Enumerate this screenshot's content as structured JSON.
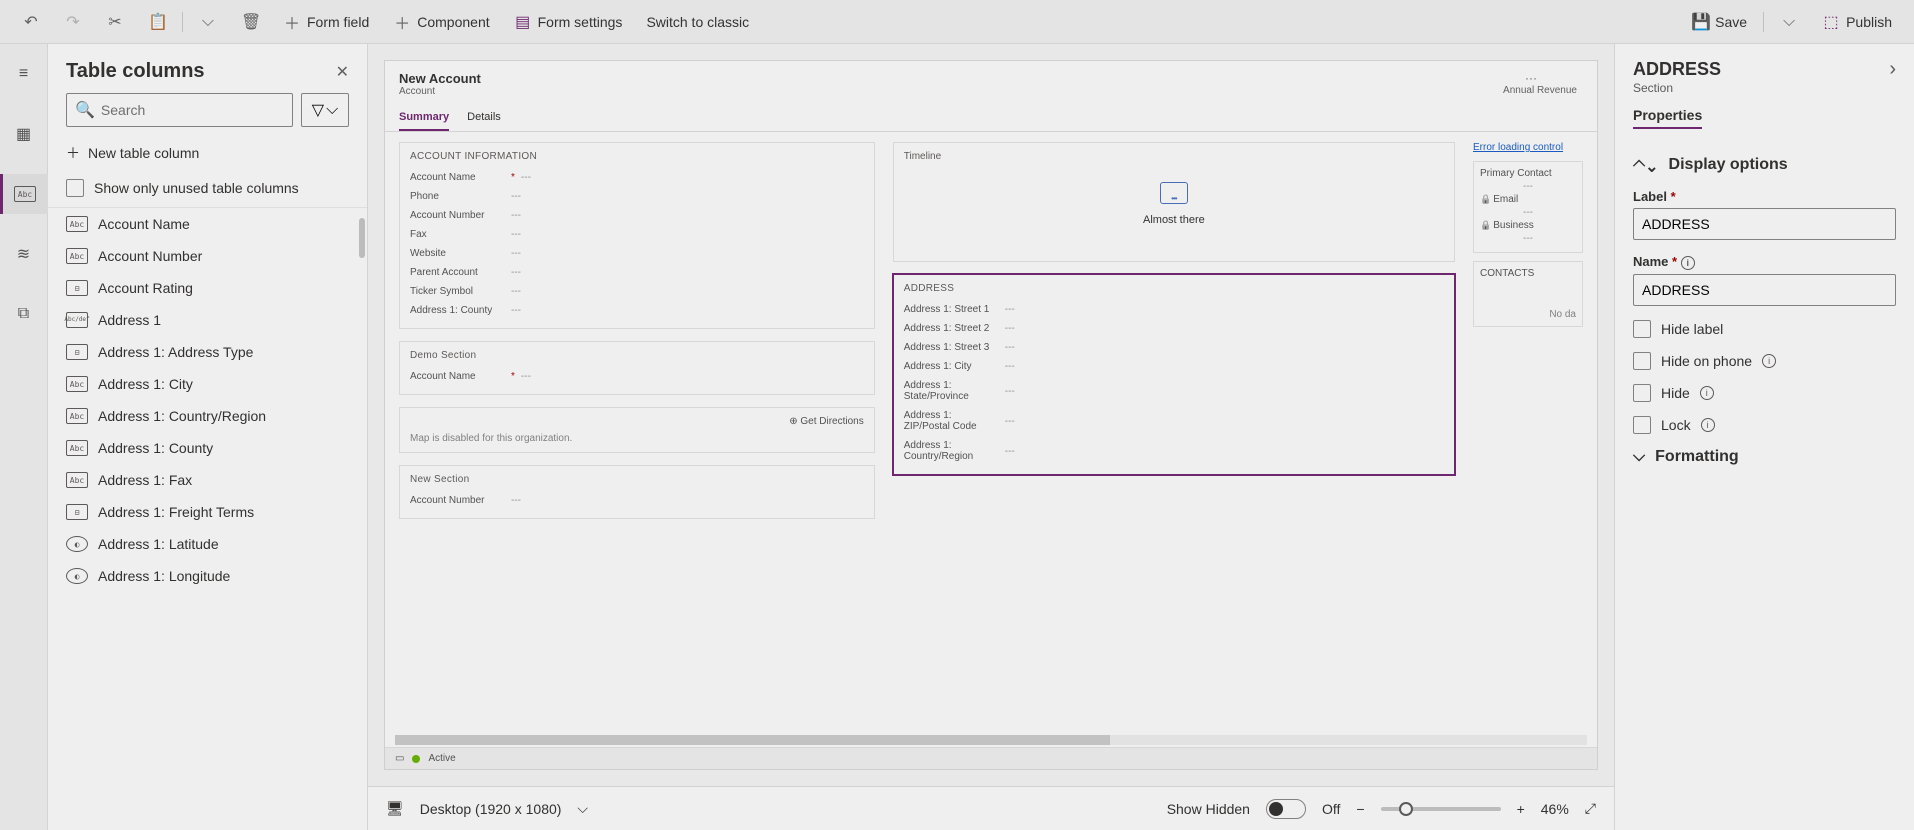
{
  "topbar": {
    "undo": "↶",
    "redo": "↷",
    "cut": "✂",
    "paste": "📋",
    "form_field": "Form field",
    "component": "Component",
    "form_settings": "Form settings",
    "switch_classic": "Switch to classic",
    "save": "Save",
    "publish": "Publish"
  },
  "table_columns": {
    "title": "Table columns",
    "search_placeholder": "Search",
    "new_table_column": "New table column",
    "show_only_unused": "Show only unused table columns",
    "items": [
      {
        "icon": "Abc",
        "label": "Account Name"
      },
      {
        "icon": "Abc",
        "label": "Account Number"
      },
      {
        "icon": "⊟",
        "label": "Account Rating"
      },
      {
        "icon": "Abc/def",
        "label": "Address 1"
      },
      {
        "icon": "⊟",
        "label": "Address 1: Address Type"
      },
      {
        "icon": "Abc",
        "label": "Address 1: City"
      },
      {
        "icon": "Abc",
        "label": "Address 1: Country/Region"
      },
      {
        "icon": "Abc",
        "label": "Address 1: County"
      },
      {
        "icon": "Abc",
        "label": "Address 1: Fax"
      },
      {
        "icon": "⊟",
        "label": "Address 1: Freight Terms"
      },
      {
        "icon": "◐",
        "label": "Address 1: Latitude"
      },
      {
        "icon": "◐",
        "label": "Address 1: Longitude"
      }
    ]
  },
  "canvas": {
    "header": {
      "title": "New Account",
      "subtitle": "Account",
      "revenue_label": "Annual Revenue",
      "ellipsis": "···"
    },
    "tabs": [
      {
        "label": "Summary",
        "active": true
      },
      {
        "label": "Details",
        "active": false
      }
    ],
    "account_info": {
      "title": "ACCOUNT INFORMATION",
      "fields": [
        {
          "name": "Account Name",
          "required": true,
          "value": "---"
        },
        {
          "name": "Phone",
          "value": "---"
        },
        {
          "name": "Account Number",
          "value": "---"
        },
        {
          "name": "Fax",
          "value": "---"
        },
        {
          "name": "Website",
          "value": "---"
        },
        {
          "name": "Parent Account",
          "value": "---"
        },
        {
          "name": "Ticker Symbol",
          "value": "---"
        },
        {
          "name": "Address 1: County",
          "value": "---"
        }
      ]
    },
    "demo_section": {
      "title": "Demo Section",
      "field_name": "Account Name",
      "required": true,
      "value": "---"
    },
    "map_section": {
      "get_directions": "Get Directions",
      "disabled_msg": "Map is disabled for this organization."
    },
    "new_section": {
      "title": "New Section",
      "field_name": "Account Number",
      "value": "---"
    },
    "timeline": {
      "title": "Timeline",
      "empty_msg": "Almost there"
    },
    "address": {
      "title": "ADDRESS",
      "fields": [
        {
          "name": "Address 1: Street 1",
          "value": "---"
        },
        {
          "name": "Address 1: Street 2",
          "value": "---"
        },
        {
          "name": "Address 1: Street 3",
          "value": "---"
        },
        {
          "name": "Address 1: City",
          "value": "---"
        },
        {
          "name": "Address 1: State/Province",
          "value": "---"
        },
        {
          "name": "Address 1: ZIP/Postal Code",
          "value": "---"
        },
        {
          "name": "Address 1: Country/Region",
          "value": "---"
        }
      ]
    },
    "side": {
      "error": "Error loading control",
      "primary_contact": "Primary Contact",
      "email": "Email",
      "business": "Business",
      "contacts": "CONTACTS",
      "nodata": "No da",
      "dash": "---"
    },
    "status_bar": {
      "status": "Active"
    }
  },
  "bottom": {
    "desktop": "Desktop (1920 x 1080)",
    "show_hidden": "Show Hidden",
    "off": "Off",
    "zoom": "46%"
  },
  "props": {
    "title": "ADDRESS",
    "subtitle": "Section",
    "tab": "Properties",
    "display_options": "Display options",
    "label_label": "Label",
    "label_value": "ADDRESS",
    "name_label": "Name",
    "name_value": "ADDRESS",
    "hide_label": "Hide label",
    "hide_on_phone": "Hide on phone",
    "hide": "Hide",
    "lock": "Lock",
    "formatting": "Formatting"
  }
}
